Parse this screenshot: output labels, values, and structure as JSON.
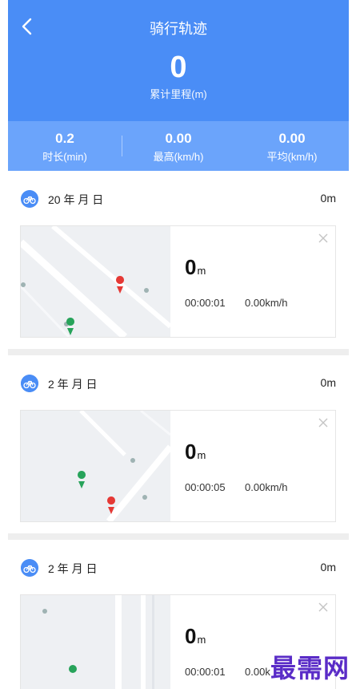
{
  "header": {
    "title": "骑行轨迹",
    "total_distance": "0",
    "total_label": "累计里程(m)"
  },
  "stats": [
    {
      "value": "0.2",
      "label": "时长(min)"
    },
    {
      "value": "0.00",
      "label": "最高(km/h)"
    },
    {
      "value": "0.00",
      "label": "平均(km/h)"
    }
  ],
  "records": [
    {
      "date": "20  年  月  日",
      "distance": "0m",
      "big_distance": "0",
      "big_unit": "m",
      "duration": "00:00:01",
      "speed_value": "0.00",
      "speed_unit": "km/h"
    },
    {
      "date": "2    年  月  日",
      "distance": "0m",
      "big_distance": "0",
      "big_unit": "m",
      "duration": "00:00:05",
      "speed_value": "0.00",
      "speed_unit": "km/h"
    },
    {
      "date": "2    年  月  日",
      "distance": "0m",
      "big_distance": "0",
      "big_unit": "m",
      "duration": "00:00:01",
      "speed_value": "0.00",
      "speed_unit": "k"
    }
  ],
  "watermark": "最需网",
  "colors": {
    "primary": "#4a8df6",
    "stats_bg": "#6ba4fb",
    "start_pin": "#27a35a",
    "end_pin": "#e53935"
  },
  "icons": {
    "back": "chevron-left-icon",
    "bike": "bicycle-icon",
    "close": "close-icon"
  }
}
